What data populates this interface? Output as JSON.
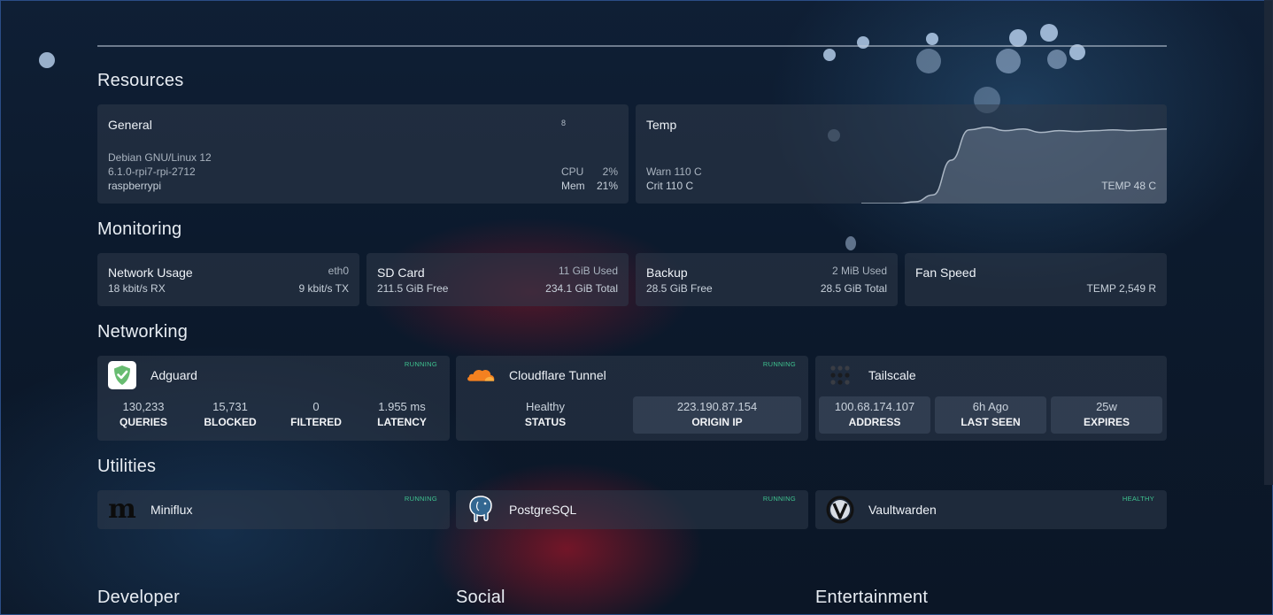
{
  "sections": {
    "resources": "Resources",
    "monitoring": "Monitoring",
    "networking": "Networking",
    "utilities": "Utilities",
    "developer": "Developer",
    "social": "Social",
    "entertainment": "Entertainment"
  },
  "resources": {
    "general": {
      "title": "General",
      "count": "8",
      "os": "Debian GNU/Linux 12",
      "kernel": "6.1.0-rpi7-rpi-2712",
      "hostname": "raspberrypi",
      "cpu_label": "CPU",
      "cpu_value": "2%",
      "mem_label": "Mem",
      "mem_value": "21%"
    },
    "temp": {
      "title": "Temp",
      "warn": "Warn 110 C",
      "crit": "Crit 110 C",
      "current": "TEMP 48 C",
      "sparkline_fraction": [
        0.0,
        0.0,
        0.0,
        0.02,
        0.1,
        0.5,
        0.85,
        0.88,
        0.84,
        0.86,
        0.82,
        0.84,
        0.83,
        0.84,
        0.85,
        0.84,
        0.85,
        0.86
      ]
    }
  },
  "monitoring": [
    {
      "title": "Network Usage",
      "right_top": "eth0",
      "left_bottom": "18 kbit/s RX",
      "right_bottom": "9 kbit/s TX"
    },
    {
      "title": "SD Card",
      "right_top": "11 GiB Used",
      "left_bottom": "211.5 GiB Free",
      "right_bottom": "234.1 GiB Total"
    },
    {
      "title": "Backup",
      "right_top": "2 MiB Used",
      "left_bottom": "28.5 GiB Free",
      "right_bottom": "28.5 GiB Total"
    },
    {
      "title": "Fan Speed",
      "right_top": "",
      "left_bottom": "",
      "right_bottom": "TEMP 2,549 R"
    }
  ],
  "networking": [
    {
      "name": "Adguard",
      "status": "RUNNING",
      "icon": "adguard-shield-icon",
      "stats": [
        {
          "value": "130,233",
          "label": "QUERIES"
        },
        {
          "value": "15,731",
          "label": "BLOCKED"
        },
        {
          "value": "0",
          "label": "FILTERED"
        },
        {
          "value": "1.955 ms",
          "label": "LATENCY"
        }
      ]
    },
    {
      "name": "Cloudflare Tunnel",
      "status": "RUNNING",
      "icon": "cloudflare-cloud-icon",
      "stats": [
        {
          "value": "Healthy",
          "label": "STATUS"
        },
        {
          "value": "223.190.87.154",
          "label": "ORIGIN IP"
        }
      ]
    },
    {
      "name": "Tailscale",
      "status": "",
      "icon": "tailscale-dots-icon",
      "stats": [
        {
          "value": "100.68.174.107",
          "label": "ADDRESS"
        },
        {
          "value": "6h Ago",
          "label": "LAST SEEN"
        },
        {
          "value": "25w",
          "label": "EXPIRES"
        }
      ]
    }
  ],
  "utilities": [
    {
      "name": "Miniflux",
      "status": "RUNNING",
      "icon": "miniflux-m-icon"
    },
    {
      "name": "PostgreSQL",
      "status": "RUNNING",
      "icon": "postgresql-elephant-icon"
    },
    {
      "name": "Vaultwarden",
      "status": "HEALTHY",
      "icon": "vaultwarden-v-icon"
    }
  ],
  "colors": {
    "status_green": "#3ec28f",
    "adguard_green": "#68bc71",
    "cloudflare_orange": "#f48120"
  }
}
